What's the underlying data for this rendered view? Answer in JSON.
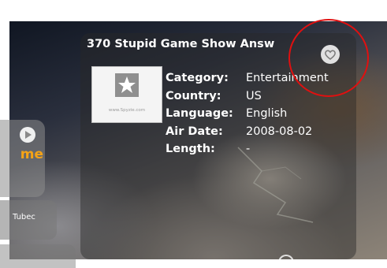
{
  "show": {
    "title": "370 Stupid Game Show Answ",
    "logo_site_text": "www.Spyzie.com",
    "fields": [
      {
        "label": "Category:",
        "value": "Entertainment"
      },
      {
        "label": "Country:",
        "value": "US"
      },
      {
        "label": "Language:",
        "value": "English"
      },
      {
        "label": "Air Date:",
        "value": "2008-08-02"
      },
      {
        "label": "Length:",
        "value": "-"
      }
    ],
    "favorite_icon": "heart-icon"
  },
  "side_tabs": {
    "tab1_text": "me",
    "tab1_icon": "play-icon",
    "tab2_text": "Tubec"
  },
  "colors": {
    "accent_orange": "#f5a316",
    "highlight_red": "#e01010"
  }
}
